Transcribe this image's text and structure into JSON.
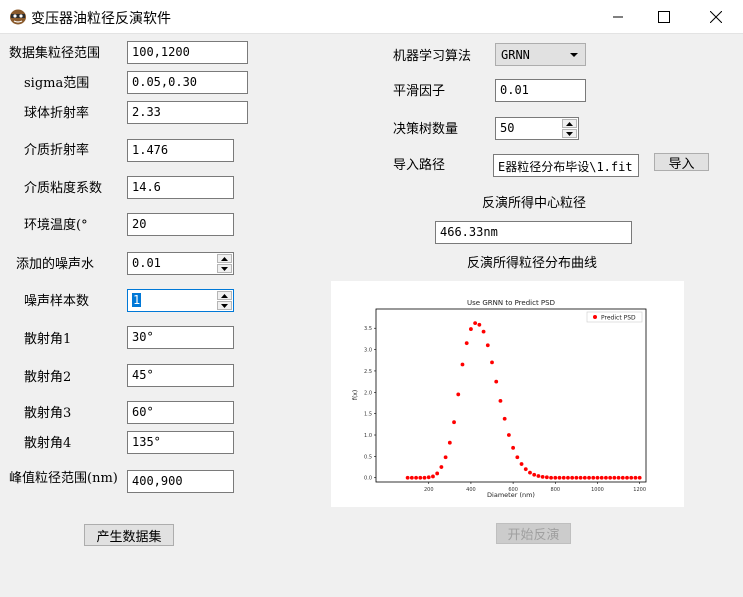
{
  "window": {
    "title": "变压器油粒径反演软件",
    "controls": [
      "minimize-icon",
      "maximize-icon",
      "close-icon"
    ]
  },
  "left_form": {
    "dataset_range": {
      "label": "数据集粒径范围",
      "value": "100,1200"
    },
    "sigma_range": {
      "label": "sigma范围",
      "value": "0.05,0.30"
    },
    "sphere_ri": {
      "label": "球体折射率",
      "value": "2.33"
    },
    "medium_ri": {
      "label": "介质折射率",
      "value": "1.476"
    },
    "medium_viscosity": {
      "label": "介质粘度系数",
      "value": "14.6"
    },
    "env_temp": {
      "label": "环境温度(°",
      "value": "20"
    },
    "noise_level": {
      "label": "添加的噪声水",
      "value": "0.01"
    },
    "noise_samples": {
      "label": "噪声样本数",
      "value": "1"
    },
    "angle1": {
      "label": "散射角1",
      "value": "30°"
    },
    "angle2": {
      "label": "散射角2",
      "value": "45°"
    },
    "angle3": {
      "label": "散射角3",
      "value": "60°"
    },
    "angle4": {
      "label": "散射角4",
      "value": "135°"
    },
    "peak_range": {
      "label": "峰值粒径范围(nm)",
      "value": "400,900"
    },
    "generate_button": "产生数据集"
  },
  "right_form": {
    "algorithm": {
      "label": "机器学习算法",
      "value": "GRNN"
    },
    "smoothing": {
      "label": "平滑因子",
      "value": "0.01"
    },
    "trees": {
      "label": "决策树数量",
      "value": "50"
    },
    "import_path": {
      "label": "导入路径",
      "value": "E器粒径分布毕设\\1.fit"
    },
    "import_button": "导入",
    "center_size_label": "反演所得中心粒径",
    "center_size_value": "466.33nm",
    "curve_label": "反演所得粒径分布曲线",
    "start_button": "开始反演"
  },
  "chart_data": {
    "type": "scatter",
    "title": "Use GRNN to Predict PSD",
    "xlabel": "Diameter (nm)",
    "ylabel": "f(x)",
    "legend": "top-right",
    "legend_entry": "Predict PSD",
    "color": "#ff0000",
    "xlim": [
      -50,
      1230
    ],
    "ylim": [
      -0.1,
      3.95
    ],
    "xticks": [
      "200",
      "400",
      "600",
      "800",
      "1000",
      "1200"
    ],
    "yticks": [
      "0.0",
      "0.5",
      "1.0",
      "1.5",
      "2.0",
      "2.5",
      "3.0",
      "3.5"
    ],
    "grid": false,
    "series": [
      {
        "name": "Predict PSD",
        "x": [
          100,
          120,
          140,
          160,
          180,
          200,
          220,
          240,
          260,
          280,
          300,
          320,
          340,
          360,
          380,
          400,
          420,
          440,
          460,
          480,
          500,
          520,
          540,
          560,
          580,
          600,
          620,
          640,
          660,
          680,
          700,
          720,
          740,
          760,
          780,
          800,
          820,
          840,
          860,
          880,
          900,
          920,
          940,
          960,
          980,
          1000,
          1020,
          1040,
          1060,
          1080,
          1100,
          1120,
          1140,
          1160,
          1180,
          1200
        ],
        "y": [
          0.0,
          0.0,
          0.0,
          0.0,
          0.0,
          0.01,
          0.03,
          0.1,
          0.25,
          0.48,
          0.82,
          1.3,
          1.95,
          2.65,
          3.15,
          3.48,
          3.62,
          3.58,
          3.42,
          3.1,
          2.7,
          2.25,
          1.8,
          1.38,
          1.0,
          0.7,
          0.48,
          0.32,
          0.2,
          0.12,
          0.07,
          0.04,
          0.02,
          0.01,
          0.0,
          0.0,
          0.0,
          0.0,
          0.0,
          0.0,
          0.0,
          0.0,
          0.0,
          0.0,
          0.0,
          0.0,
          0.0,
          0.0,
          0.0,
          0.0,
          0.0,
          0.0,
          0.0,
          0.0,
          0.0,
          0.0
        ]
      }
    ]
  }
}
